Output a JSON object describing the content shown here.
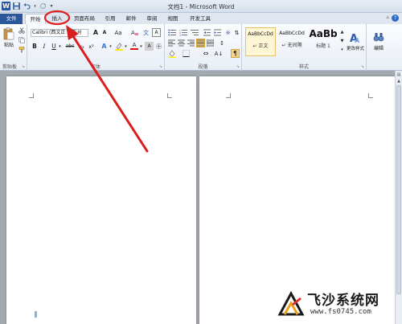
{
  "window": {
    "title": "文档1 - Microsoft Word",
    "app_icon": "W"
  },
  "quick_access": [
    "save-icon",
    "undo-icon",
    "redo-icon",
    "customize-icon"
  ],
  "tabs": [
    {
      "label": "文件",
      "id": "file"
    },
    {
      "label": "开始",
      "id": "home",
      "active": true
    },
    {
      "label": "插入",
      "id": "insert",
      "highlighted": true
    },
    {
      "label": "页面布局",
      "id": "page-layout"
    },
    {
      "label": "引用",
      "id": "references"
    },
    {
      "label": "邮件",
      "id": "mailings"
    },
    {
      "label": "审阅",
      "id": "review"
    },
    {
      "label": "视图",
      "id": "view"
    },
    {
      "label": "开发工具",
      "id": "developer"
    }
  ],
  "ribbon": {
    "clipboard": {
      "label": "剪贴板",
      "paste_label": "粘贴"
    },
    "font": {
      "label": "字体",
      "font_name": "Calibri (西文正",
      "font_size": "五号",
      "grow": "A",
      "shrink": "A",
      "change_case": "Aa",
      "bold": "B",
      "italic": "I",
      "underline": "U",
      "strike": "abc",
      "subscript": "x₂",
      "superscript": "x²",
      "text_effect": "A",
      "font_color": "A",
      "char_border": "A"
    },
    "paragraph": {
      "label": "段落"
    },
    "styles": {
      "label": "样式",
      "items": [
        {
          "preview": "AaBbCcDd",
          "name": "↵ 正文",
          "selected": true
        },
        {
          "preview": "AaBbCcDd",
          "name": "↵ 无间隔"
        },
        {
          "preview": "AaBb",
          "name": "标题 1"
        }
      ],
      "change_styles": "更改样式"
    },
    "editing": {
      "label": "编辑"
    }
  },
  "colors": {
    "accent": "#2b579a",
    "highlight_circle": "#e02020",
    "arrow": "#d81e1e",
    "selected_style": "#fff6d6"
  },
  "watermark": {
    "name": "飞沙系统网",
    "url": "www.fs0745.com"
  }
}
